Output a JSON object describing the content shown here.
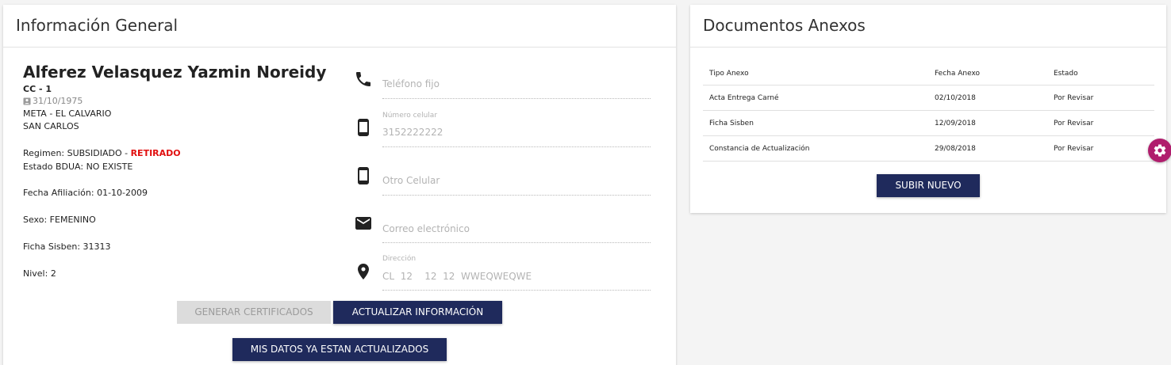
{
  "info_card": {
    "title": "Información General",
    "name": "Alferez Velasquez Yazmin Noreidy",
    "document_id": "CC - 1",
    "birth_date": "31/10/1975",
    "department": "META - EL CALVARIO",
    "municipality": "SAN CARLOS",
    "regimen_label": "Regimen:",
    "regimen_value": "SUBSIDIADO",
    "regimen_sep": " - ",
    "regimen_status": "RETIRADO",
    "bdua_label": "Estado BDUA:",
    "bdua_value": "NO EXISTE",
    "afiliacion_label": "Fecha Afiliación:",
    "afiliacion_value": "01-10-2009",
    "sexo_label": "Sexo:",
    "sexo_value": "FEMENINO",
    "sisben_label": "Ficha Sisben:",
    "sisben_value": "31313",
    "nivel_label": "Nivel:",
    "nivel_value": "2"
  },
  "contact": {
    "telefono_placeholder": "Teléfono fijo",
    "celular_label": "Número celular",
    "celular_value": "3152222222",
    "otro_celular_placeholder": "Otro Celular",
    "correo_placeholder": "Correo electrónico",
    "direccion_label": "Dirección",
    "direccion_value": "CL  12    12  12  WWEQWEQWE"
  },
  "buttons": {
    "generar": "GENERAR CERTIFICADOS",
    "actualizar": "ACTUALIZAR INFORMACIÓN",
    "mis_datos": "MIS DATOS YA ESTAN ACTUALIZADOS",
    "subir": "SUBIR NUEVO"
  },
  "docs_card": {
    "title": "Documentos Anexos",
    "columns": [
      "Tipo Anexo",
      "Fecha Anexo",
      "Estado"
    ],
    "rows": [
      {
        "tipo": "Acta Entrega Carné",
        "fecha": "02/10/2018",
        "estado": "Por Revisar"
      },
      {
        "tipo": "Ficha Sisben",
        "fecha": "12/09/2018",
        "estado": "Por Revisar"
      },
      {
        "tipo": "Constancia de Actualización",
        "fecha": "29/08/2018",
        "estado": "Por Revisar"
      }
    ]
  },
  "icons": {
    "phone": "phone-icon",
    "mobile": "mobile-icon",
    "email": "email-icon",
    "location": "location-icon",
    "settings": "gear-icon",
    "birth": "id-card-icon"
  },
  "colors": {
    "primary": "#1f2a5c",
    "danger": "#e10f0f",
    "fab": "#b01d6d"
  }
}
